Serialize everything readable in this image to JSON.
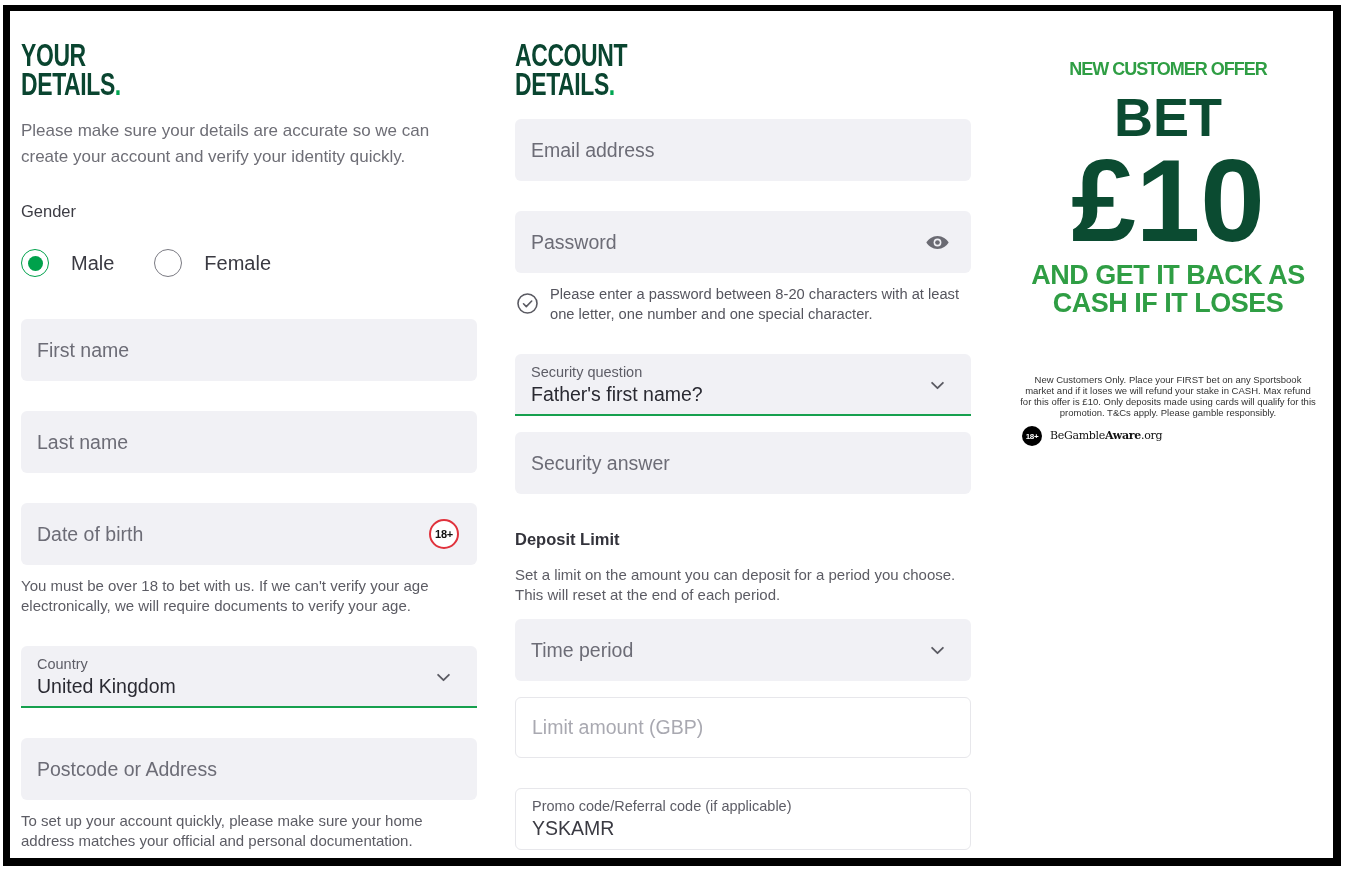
{
  "sections": [
    {
      "title": {
        "lines": [
          "YOUR",
          "DETAILS"
        ],
        "accent": "."
      },
      "intro": "Please make sure your details are accurate so we can create your account and verify your identity quickly.",
      "gender": {
        "label": "Gender",
        "options": [
          {
            "label": "Male",
            "selected": true
          },
          {
            "label": "Female",
            "selected": false
          }
        ]
      },
      "groups": [
        [
          {
            "kind": "input",
            "placeholder": "First name",
            "disabled": false
          }
        ],
        [
          {
            "kind": "input",
            "placeholder": "Last name",
            "disabled": false
          }
        ],
        [
          {
            "kind": "input",
            "placeholder": "Date of birth",
            "badge": "18+",
            "disabled": false
          },
          {
            "kind": "note",
            "text": "You must be over 18 to bet with us. If we can't verify your age electronically, we will require documents to verify your age."
          }
        ],
        [
          {
            "kind": "select",
            "label": "Country",
            "value": "United Kingdom",
            "disabled": false
          }
        ],
        [
          {
            "kind": "input",
            "placeholder": "Postcode or Address",
            "disabled": false
          },
          {
            "kind": "note",
            "text": "To set up your account quickly, please make sure your home address matches your official and personal documentation."
          }
        ]
      ]
    },
    {
      "title": {
        "lines": [
          "ACCOUNT",
          "DETAILS"
        ],
        "accent": "."
      },
      "groups": [
        [
          {
            "kind": "input",
            "placeholder": "Email address",
            "disabled": false
          }
        ],
        [
          {
            "kind": "password",
            "placeholder": "Password",
            "disabled": false
          },
          {
            "kind": "hint",
            "text": "Please enter a password between 8-20 characters with at least one letter, one number and one special character."
          }
        ],
        [
          {
            "kind": "select",
            "label": "Security question",
            "value": "Father's first name?",
            "disabled": false
          },
          {
            "kind": "input",
            "placeholder": "Security answer",
            "disabled": false
          }
        ],
        [
          {
            "kind": "heading",
            "text": "Deposit Limit"
          },
          {
            "kind": "note",
            "text": "Set a limit on the amount you can deposit for a period you choose. This will reset at the end of each period."
          },
          {
            "kind": "select",
            "placeholder": "Time period",
            "disabled": false
          },
          {
            "kind": "input",
            "placeholder": "Limit amount (GBP)",
            "disabled": true
          }
        ],
        [
          {
            "kind": "input",
            "label": "Promo code/Referral code (if applicable)",
            "value": "YSKAMR",
            "disabled": false
          }
        ]
      ]
    }
  ],
  "promo": {
    "eyebrow": "NEW CUSTOMER OFFER",
    "headline": "BET",
    "amount": "£10",
    "subhead": [
      "AND GET IT BACK AS",
      "CASH IF IT LOSES"
    ],
    "terms": "New Customers Only. Place your FIRST bet on any Sportsbook market and if it loses we will refund your stake in CASH. Max refund for this offer is £10. Only deposits made using cards will qualify for this promotion. T&Cs apply. Please gamble responsibly.",
    "age_badge": "18+",
    "gamble_aware": "BeGamble**Aware**.org"
  }
}
